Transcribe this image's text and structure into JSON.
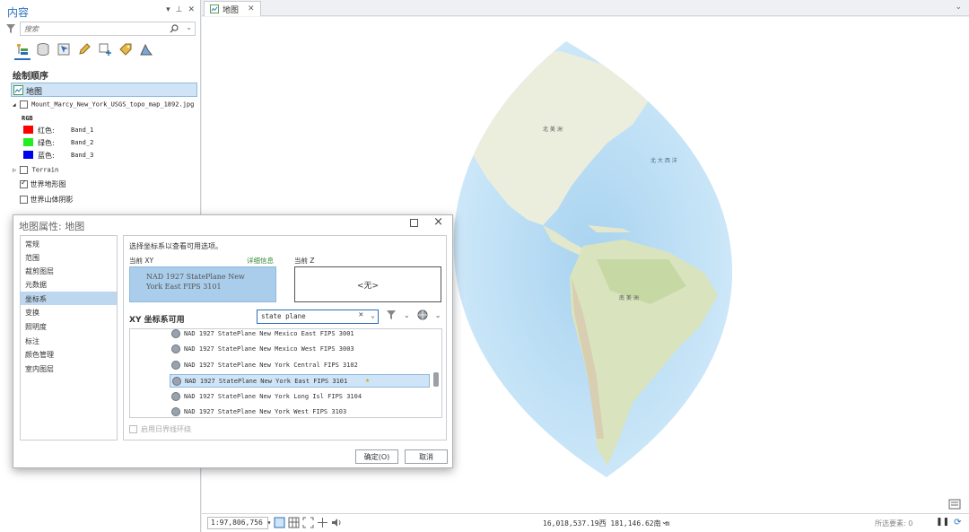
{
  "contents": {
    "title": "内容",
    "search_placeholder": "搜索",
    "section_title": "绘制顺序",
    "map_label": "地图",
    "layers": {
      "topo": "Mount_Marcy_New_York_USGS_topo_map_1892.jpg",
      "rgb": "RGB",
      "red": "红色:",
      "red_band": "Band_1",
      "green": "绿色:",
      "green_band": "Band_2",
      "blue": "蓝色:",
      "blue_band": "Band_3",
      "terrain": "Terrain",
      "world_topo": "世界地形图",
      "world_hillshade": "世界山体阴影"
    }
  },
  "map_tab": "地图",
  "map_labels": {
    "north_america": "北 美 洲",
    "north_atlantic": "北 大 西 洋",
    "south_america": "南 美 洲"
  },
  "status": {
    "scale": "1:97,806,756",
    "coords": "16,018,537.19西 181,146.62南 m",
    "selected": "所选要素: 0"
  },
  "dialog": {
    "title": "地图属性: 地图",
    "nav": [
      "常规",
      "范围",
      "裁剪图层",
      "元数据",
      "坐标系",
      "变换",
      "照明度",
      "标注",
      "颜色管理",
      "室内图层"
    ],
    "active_nav": "坐标系",
    "instruction": "选择坐标系以查看可用选项。",
    "current_xy_label": "当前 XY",
    "details_link": "详细信息",
    "current_z_label": "当前 Z",
    "current_xy": "NAD 1927 StatePlane New York East FIPS 3101",
    "current_z": "<无>",
    "available_title": "XY 坐标系可用",
    "search_value": "state plane",
    "list": [
      "NAD 1927 StatePlane New Mexico East FIPS 3001",
      "NAD 1927 StatePlane New Mexico West FIPS 3003",
      "NAD 1927 StatePlane New York Central FIPS 3102",
      "NAD 1927 StatePlane New York East FIPS 3101",
      "NAD 1927 StatePlane New York Long Isl FIPS 3104",
      "NAD 1927 StatePlane New York West FIPS 3103"
    ],
    "wrap_label": "启用日界线环绕",
    "ok": "确定(O)",
    "cancel": "取消"
  }
}
